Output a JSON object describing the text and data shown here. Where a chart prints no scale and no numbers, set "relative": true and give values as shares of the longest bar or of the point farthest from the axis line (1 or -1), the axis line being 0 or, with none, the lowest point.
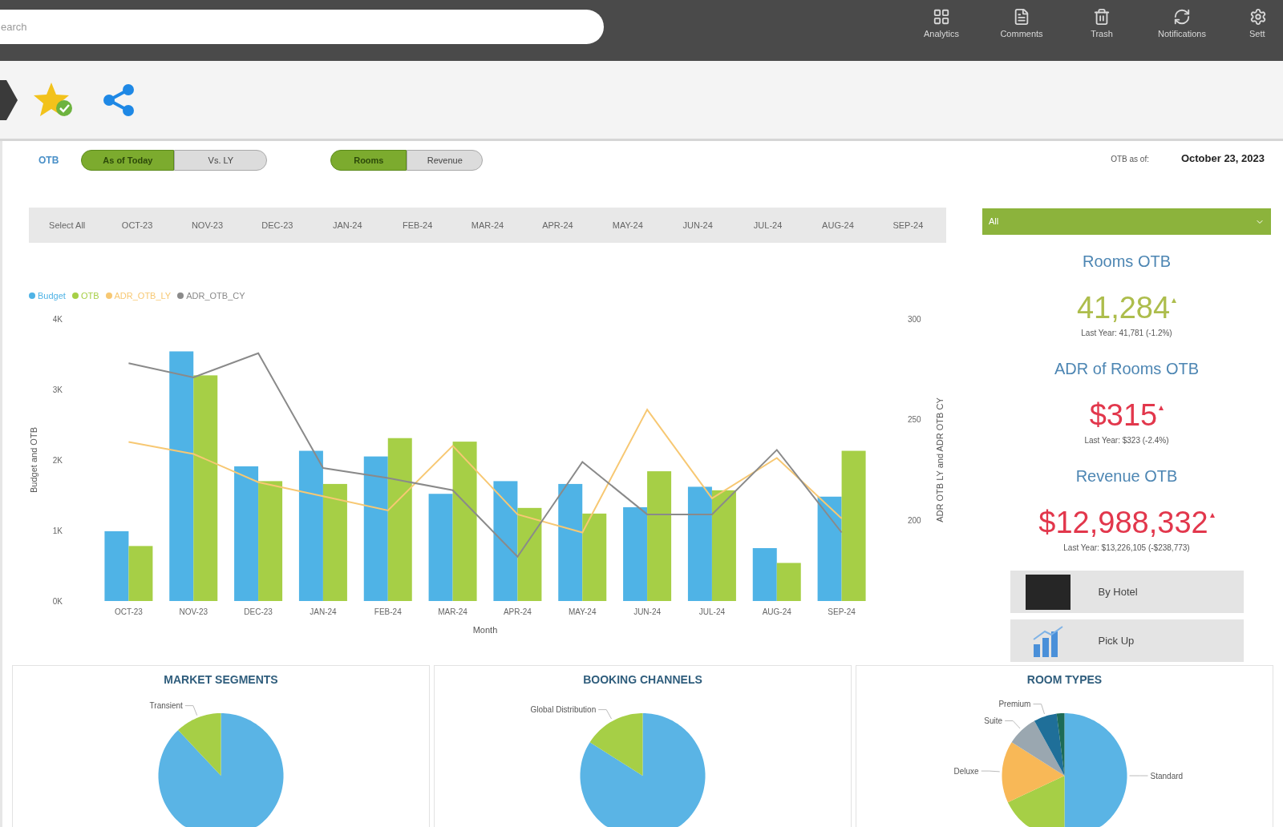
{
  "top_bar": {
    "search": {
      "placeholder": "earch"
    },
    "nav_items": [
      {
        "label": "Analytics"
      },
      {
        "label": "Comments"
      },
      {
        "label": "Trash"
      },
      {
        "label": "Notifications"
      },
      {
        "label": "Sett"
      }
    ]
  },
  "filters": {
    "label": "OTB",
    "toggle_groups": [
      {
        "options": [
          {
            "label": "As of Today",
            "selected": true
          },
          {
            "label": "Vs. LY",
            "selected": false
          }
        ]
      },
      {
        "options": [
          {
            "label": "Rooms",
            "selected": true
          },
          {
            "label": "Revenue",
            "selected": false
          }
        ]
      }
    ]
  },
  "as_of": {
    "label": "OTB as of:",
    "date": "October 23, 2023"
  },
  "month_tabs": [
    {
      "label": "Select All",
      "selected": false
    },
    {
      "label": "OCT-23",
      "selected": false
    },
    {
      "label": "NOV-23",
      "selected": false
    },
    {
      "label": "DEC-23",
      "selected": false
    },
    {
      "label": "JAN-24",
      "selected": false
    },
    {
      "label": "FEB-24",
      "selected": false
    },
    {
      "label": "MAR-24",
      "selected": false
    },
    {
      "label": "APR-24",
      "selected": false
    },
    {
      "label": "MAY-24",
      "selected": false
    },
    {
      "label": "JUN-24",
      "selected": false
    },
    {
      "label": "JUL-24",
      "selected": false
    },
    {
      "label": "AUG-24",
      "selected": false
    },
    {
      "label": "SEP-24",
      "selected": false
    }
  ],
  "hotel_select": {
    "value": "All"
  },
  "kpis": [
    {
      "title": "Rooms OTB",
      "value": "41,284",
      "color": "#adbd4c",
      "comparison": "Last Year: 41,781 (-1.2%)"
    },
    {
      "title": "ADR of Rooms OTB",
      "value": "$315",
      "color": "#e2374c",
      "comparison": "Last Year: $323 (-2.4%)"
    },
    {
      "title": "Revenue OTB",
      "value": "$12,988,332",
      "color": "#e2374c",
      "comparison": "Last Year: $13,226,105 (-$238,773)"
    }
  ],
  "buttons": [
    {
      "label": "By Hotel"
    },
    {
      "label": "Pick Up"
    }
  ],
  "main_chart": {
    "chart_data": {
      "type": "bar",
      "xlabel": "Month",
      "ylabel": "Budget and OTB",
      "y2label": "ADR OTB LY and ADR OTB CY",
      "categories": [
        "OCT-23",
        "NOV-23",
        "DEC-23",
        "JAN-24",
        "FEB-24",
        "MAR-24",
        "APR-24",
        "MAY-24",
        "JUN-24",
        "JUL-24",
        "AUG-24",
        "SEP-24"
      ],
      "series": [
        {
          "name": "Budget",
          "color": "#4fb3e6",
          "values": [
            0.99,
            3.54,
            1.91,
            2.13,
            2.05,
            1.52,
            1.7,
            1.66,
            1.33,
            1.62,
            0.75,
            1.48
          ]
        },
        {
          "name": "OTB",
          "color": "#a6cf46",
          "values": [
            0.78,
            3.2,
            1.7,
            1.66,
            2.31,
            2.26,
            1.32,
            1.24,
            1.84,
            1.57,
            0.54,
            2.13
          ]
        },
        {
          "name": "ADR_OTB_LY",
          "color": "#f7c873",
          "type": "line",
          "axis": "y2",
          "values": [
            239,
            233,
            219,
            212,
            205,
            237,
            203,
            194,
            255,
            211,
            231,
            201
          ]
        },
        {
          "name": "ADR_OTB_CY",
          "color": "#8a8a8a",
          "type": "line",
          "axis": "y2",
          "values": [
            278,
            271,
            283,
            226,
            221,
            215,
            182,
            229,
            203,
            203,
            235,
            194
          ]
        }
      ],
      "ylim": [
        0,
        4
      ],
      "yticks": [
        {
          "value": 0,
          "label": "0K"
        },
        {
          "value": 1,
          "label": "1K"
        },
        {
          "value": 2,
          "label": "2K"
        },
        {
          "value": 3,
          "label": "3K"
        },
        {
          "value": 4,
          "label": "4K"
        }
      ],
      "y2lim": [
        160,
        300
      ],
      "y2ticks": [
        200,
        250,
        300
      ]
    }
  },
  "pie_panels": [
    {
      "title": "MARKET SEGMENTS",
      "chart_data": {
        "type": "pie",
        "relative": true,
        "categories": [
          null,
          "Transient"
        ],
        "values": [
          88,
          12
        ],
        "colors": [
          "#5ab4e5",
          "#a6cf46"
        ]
      }
    },
    {
      "title": "BOOKING CHANNELS",
      "chart_data": {
        "type": "pie",
        "relative": true,
        "categories": [
          null,
          "Global Distribution"
        ],
        "values": [
          84,
          16
        ],
        "colors": [
          "#5ab4e5",
          "#a6cf46"
        ]
      }
    },
    {
      "title": "ROOM TYPES",
      "chart_data": {
        "type": "pie",
        "relative": true,
        "categories": [
          "Standard",
          null,
          "Deluxe",
          "Suite",
          "Premium",
          null
        ],
        "values": [
          50,
          18,
          16,
          8,
          6,
          2
        ],
        "colors": [
          "#5ab4e5",
          "#a6cf46",
          "#f8b857",
          "#9aa7b0",
          "#1f6f99",
          "#1d6b57"
        ]
      }
    }
  ]
}
